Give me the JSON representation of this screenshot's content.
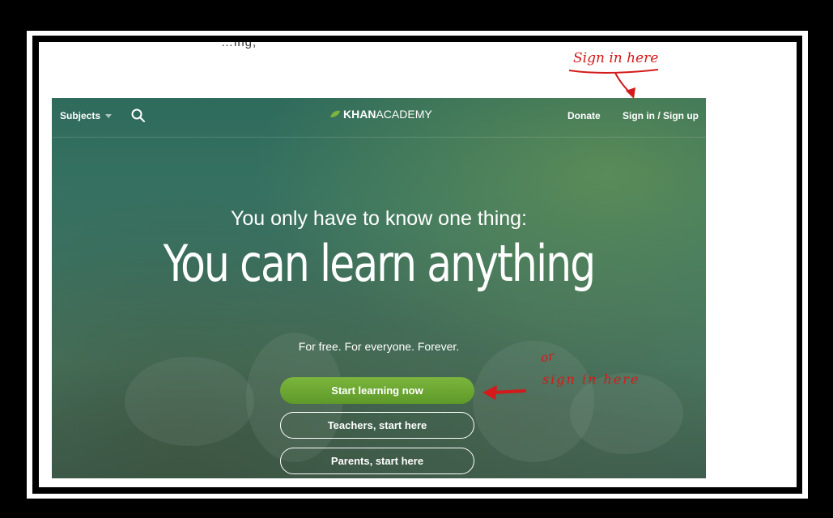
{
  "crop_text": "…ing,",
  "nav": {
    "subjects_label": "Subjects",
    "logo_bold": "KHAN",
    "logo_thin": "ACADEMY",
    "donate_label": "Donate",
    "signin_label": "Sign in / Sign up"
  },
  "hero": {
    "tagline": "You only have to know one thing:",
    "headline": "You can learn anything",
    "subline": "For free. For everyone. Forever."
  },
  "buttons": {
    "start_label": "Start learning now",
    "teachers_label": "Teachers, start here",
    "parents_label": "Parents, start here"
  },
  "annotations": {
    "top_note": "Sign in here",
    "or_note": "or",
    "side_note": "sign in here"
  },
  "colors": {
    "brand_green": "#6aa834",
    "annotation_red": "#d41a1a"
  },
  "icons": [
    "search-icon",
    "leaf-icon",
    "chevron-down-icon",
    "arrow-icon"
  ]
}
